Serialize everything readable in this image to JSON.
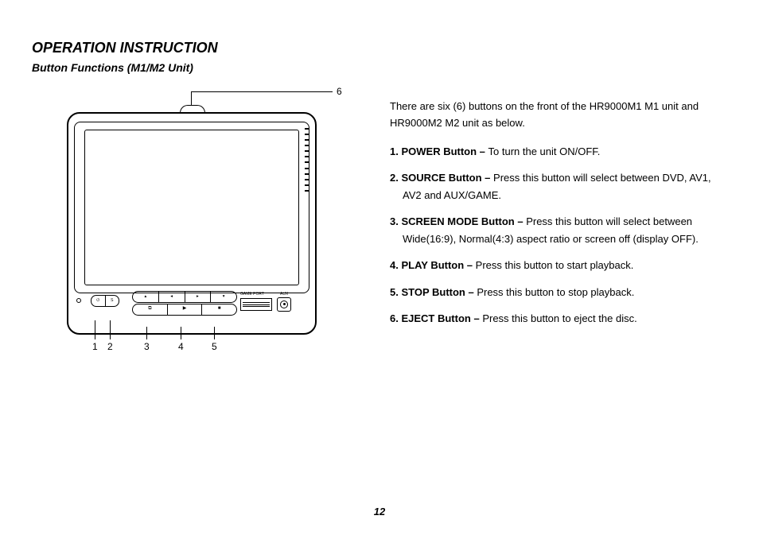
{
  "heading": "OPERATION INSTRUCTION",
  "subheading": "Button Functions (M1/M2 Unit)",
  "intro": "There are six (6) buttons on the front of the HR9000M1 M1 unit and HR9000M2 M2 unit as below.",
  "list": [
    {
      "num": "1.",
      "term": "POWER Button – ",
      "desc": "To turn the unit ON/OFF."
    },
    {
      "num": "2.",
      "term": "SOURCE Button – ",
      "desc": "Press this button will select between DVD, AV1, AV2 and AUX/GAME."
    },
    {
      "num": "3.",
      "term": "SCREEN MODE Button – ",
      "desc": "Press this button will select between Wide(16:9), Normal(4:3) aspect ratio or screen off (display OFF)."
    },
    {
      "num": "4.",
      "term": "PLAY Button – ",
      "desc": "Press this button to start playback."
    },
    {
      "num": "5.",
      "term": "STOP Button – ",
      "desc": "Press this button to stop playback."
    },
    {
      "num": "6.",
      "term": "EJECT Button – ",
      "desc": "Press this button to eject the disc."
    }
  ],
  "callouts": {
    "c1": "1",
    "c2": "2",
    "c3": "3",
    "c4": "4",
    "c5": "5",
    "c6": "6"
  },
  "device": {
    "gamePortLabel": "GAME PORT",
    "auxLabel": "AUX",
    "powerGlyph": "⏻",
    "sourceGlyph": "S",
    "navArrows": {
      "up": "▴",
      "left": "◂",
      "right": "▸",
      "down": "▾"
    },
    "screenModeGlyph": "⧉",
    "playGlyph": "▶",
    "stopGlyph": "■"
  },
  "pageNumber": "12"
}
